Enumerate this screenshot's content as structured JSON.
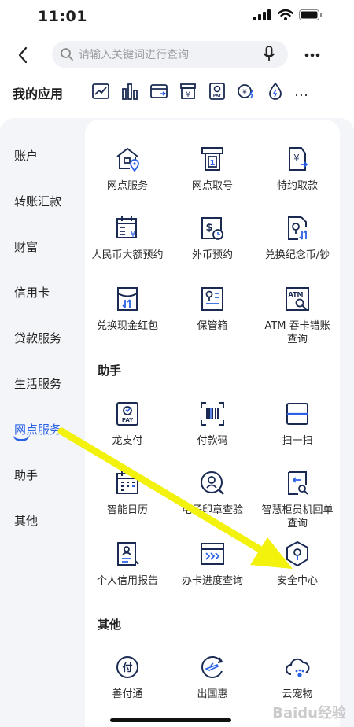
{
  "status": {
    "time": "11:01"
  },
  "search": {
    "placeholder": "请输入关键词进行查询"
  },
  "my_apps": {
    "title": "我的应用",
    "icons": [
      "trend-chart-icon",
      "bar-chart-icon",
      "card-transfer-icon",
      "yuan-box-icon",
      "pay-card-icon",
      "yuan-lightning-icon",
      "drop-bolt-icon"
    ],
    "more": "…"
  },
  "sidebar": {
    "items": [
      "账户",
      "转账汇款",
      "财富",
      "信用卡",
      "贷款服务",
      "生活服务",
      "网点服务",
      "助手",
      "其他"
    ],
    "active_index": 6
  },
  "sections": {
    "branch": {
      "items": [
        {
          "label": "网点服务",
          "icon": "bank-location-icon"
        },
        {
          "label": "网点取号",
          "icon": "queue-number-icon"
        },
        {
          "label": "特约取款",
          "icon": "yuan-withdraw-icon"
        },
        {
          "label": "人民币大额预约",
          "icon": "calendar-yuan-icon"
        },
        {
          "label": "外币预约",
          "icon": "dollar-clock-icon"
        },
        {
          "label": "兑换纪念币/钞",
          "icon": "coin-exchange-icon"
        },
        {
          "label": "兑换现金红包",
          "icon": "red-envelope-icon"
        },
        {
          "label": "保管箱",
          "icon": "safe-box-icon"
        },
        {
          "label": "ATM 吞卡错账\n查询",
          "icon": "atm-search-icon"
        }
      ]
    },
    "assistant": {
      "title": "助手",
      "items": [
        {
          "label": "龙支付",
          "icon": "long-pay-icon"
        },
        {
          "label": "付款码",
          "icon": "barcode-icon"
        },
        {
          "label": "扫一扫",
          "icon": "scan-icon"
        },
        {
          "label": "智能日历",
          "icon": "smart-calendar-icon"
        },
        {
          "label": "电子印章查验",
          "icon": "seal-verify-icon"
        },
        {
          "label": "智慧柜员机回单\n查询",
          "icon": "receipt-query-icon"
        },
        {
          "label": "个人信用报告",
          "icon": "credit-report-icon"
        },
        {
          "label": "办卡进度查询",
          "icon": "card-progress-icon"
        },
        {
          "label": "安全中心",
          "icon": "security-shield-icon"
        }
      ]
    },
    "others": {
      "title": "其他",
      "items": [
        {
          "label": "善付通",
          "icon": "shanfutong-icon"
        },
        {
          "label": "出国惠",
          "icon": "flight-globe-icon"
        },
        {
          "label": "云宠物",
          "icon": "cloud-pet-icon"
        }
      ]
    }
  },
  "annotation": {
    "color": "#f2f20c"
  },
  "colors": {
    "accent": "#2b61e6",
    "icon": "#1a2a52"
  },
  "watermark": "Baidu经验"
}
